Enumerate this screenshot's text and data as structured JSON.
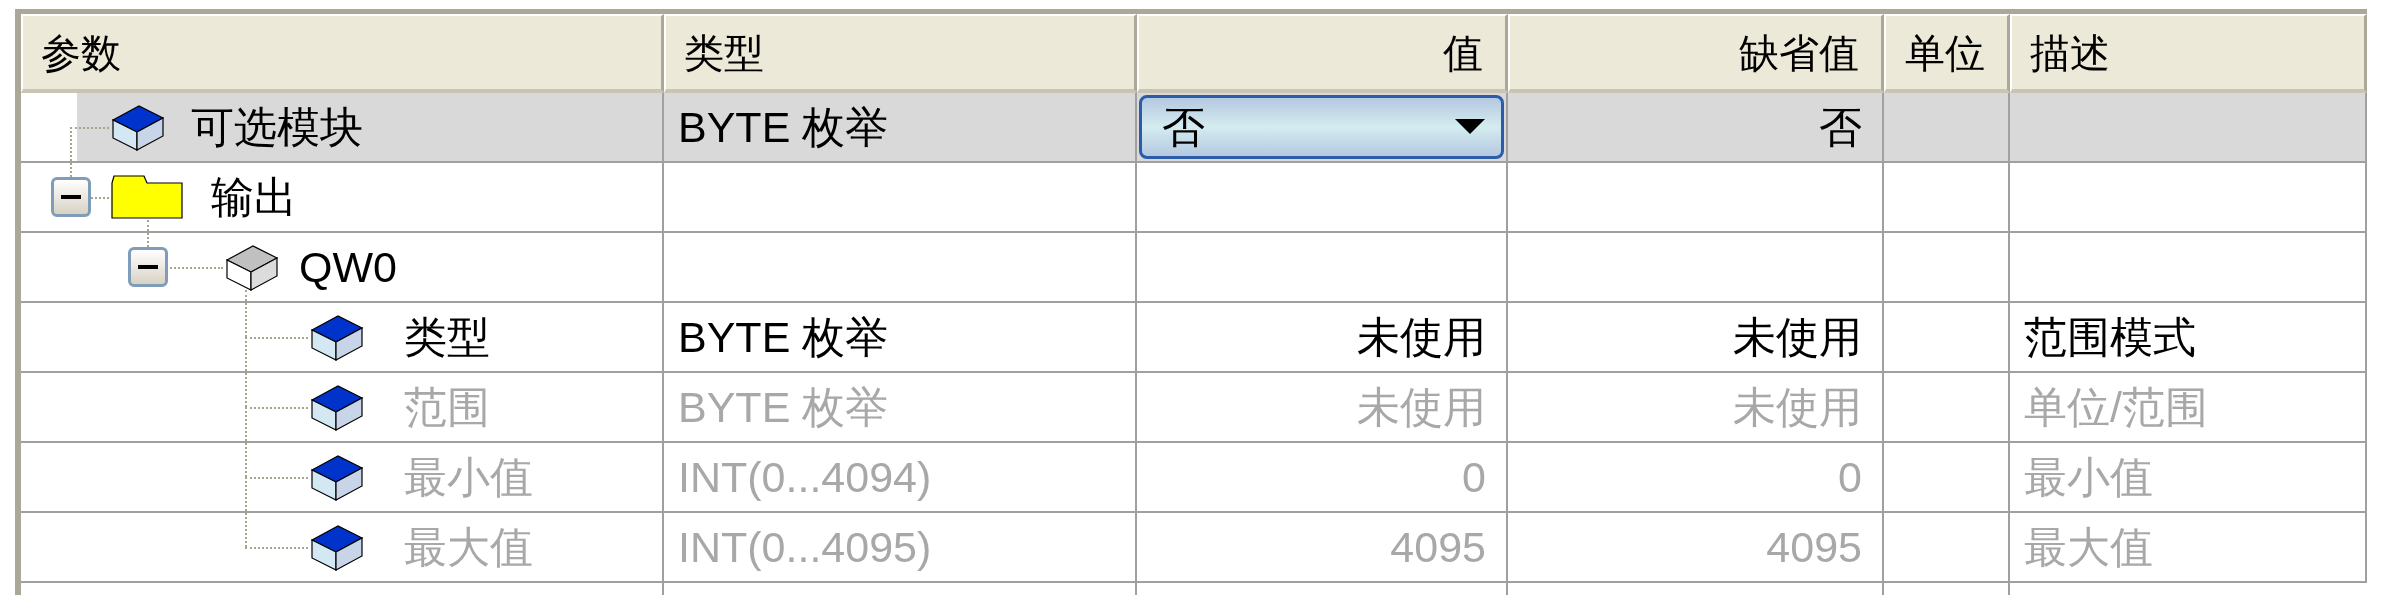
{
  "columns": [
    "参数",
    "类型",
    "值",
    "缺省值",
    "单位",
    "描述"
  ],
  "tree": [
    {
      "kind": "module",
      "label": "可选模块",
      "selected": true,
      "disabled": false,
      "type": "BYTE 枚举",
      "value": {
        "kind": "dropdown",
        "text": "否"
      },
      "default": "否"
    },
    {
      "kind": "folder",
      "label": "输出",
      "selected": false,
      "disabled": false,
      "expanded": true,
      "children": [
        {
          "kind": "channel",
          "label": "QW0",
          "selected": false,
          "disabled": false,
          "expanded": true,
          "children": [
            {
              "kind": "param",
              "label": "类型",
              "selected": false,
              "disabled": false,
              "type": "BYTE 枚举",
              "value": "未使用",
              "default": "未使用",
              "description": "范围模式"
            },
            {
              "kind": "param",
              "label": "范围",
              "selected": false,
              "disabled": true,
              "type": "BYTE 枚举",
              "value": "未使用",
              "default": "未使用",
              "description": "单位/范围"
            },
            {
              "kind": "param",
              "label": "最小值",
              "selected": false,
              "disabled": true,
              "type": "INT(0...4094)",
              "value": "0",
              "default": "0",
              "description": "最小值"
            },
            {
              "kind": "param",
              "label": "最大值",
              "selected": false,
              "disabled": true,
              "type": "INT(0...4095)",
              "value": "4095",
              "default": "4095",
              "description": "最大值"
            }
          ]
        }
      ]
    }
  ]
}
